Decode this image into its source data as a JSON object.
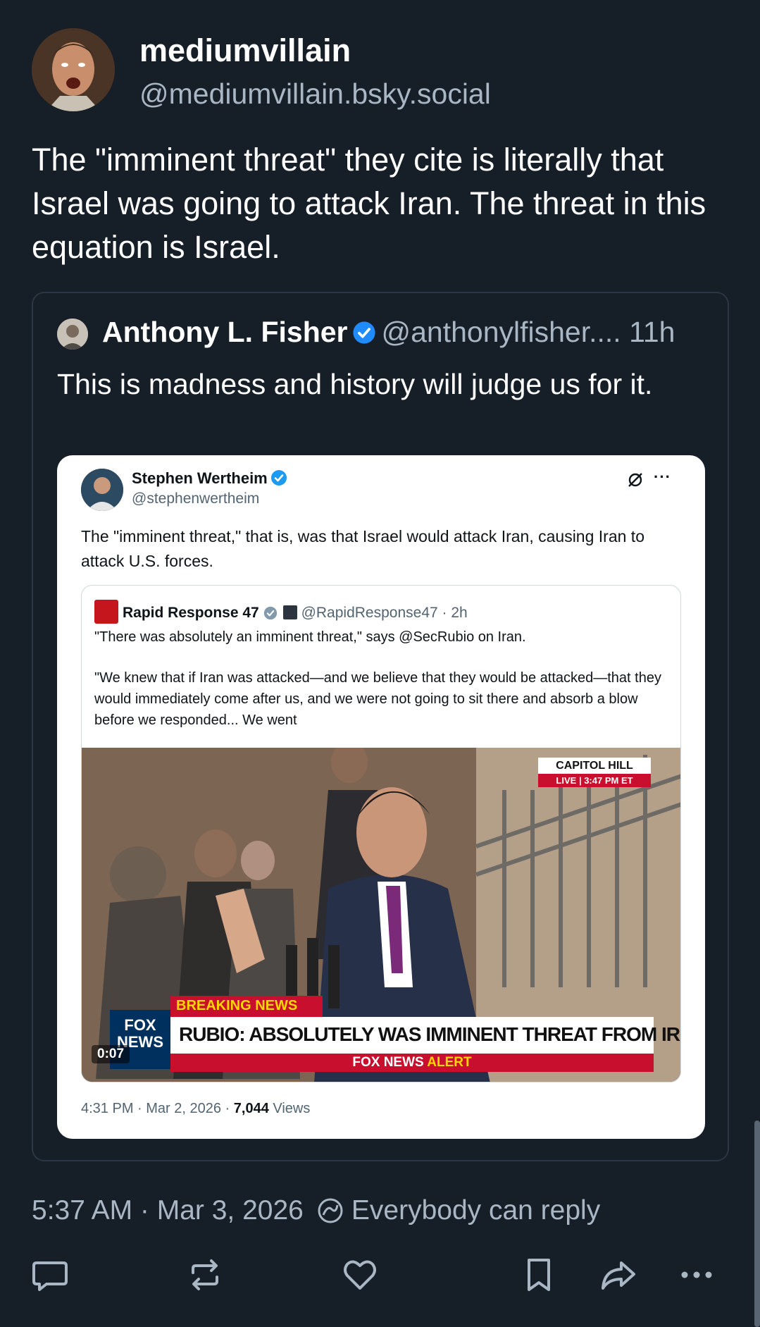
{
  "post": {
    "author_name": "mediumvillain",
    "author_handle": "@mediumvillain.bsky.social",
    "text": "The \"imminent threat\" they cite is literally that Israel was going to attack Iran. The threat in this equation is Israel.",
    "timestamp": "5:37 AM · Mar 3, 2026",
    "reply_setting": "Everybody can reply"
  },
  "quote": {
    "author_name": "Anthony L. Fisher",
    "author_handle": "@anthonylfisher....",
    "age": "11h",
    "text": "This is madness and history will judge us for it.",
    "embed": {
      "author_name": "Stephen Wertheim",
      "author_handle": "@stephenwertheim",
      "more": "···",
      "text": "The \"imminent threat,\" that is, was that Israel would attack Iran, causing Iran to attack U.S. forces.",
      "inner": {
        "author_name": "Rapid Response 47",
        "author_handle": "@RapidResponse47",
        "age": "· 2h",
        "text1": "\"There was absolutely an imminent threat,\" says @SecRubio on Iran.",
        "text2": "\"We knew that if Iran was attacked—and we believe that they would be attacked—that they would immediately come after us, and we were not going to sit there and absorb a blow before we responded... We went",
        "video": {
          "location": "CAPITOL HILL",
          "live": "LIVE",
          "live_time": "3:47 PM ET",
          "breaking": "BREAKING NEWS",
          "headline": "RUBIO: ABSOLUTELY WAS IMMINENT THREAT FROM IRAN",
          "alert_prefix": "FOX NEWS",
          "alert_suffix": "ALERT",
          "logo_line1": "FOX",
          "logo_line2": "NEWS",
          "timecode": "0:07"
        }
      },
      "footer_meta": "4:31 PM · Mar 2, 2026 · ",
      "footer_views_count": "7,044",
      "footer_views_label": " Views"
    }
  },
  "colors": {
    "background": "#161e27",
    "accent": "#208bfe",
    "muted": "#a9b6c4"
  }
}
